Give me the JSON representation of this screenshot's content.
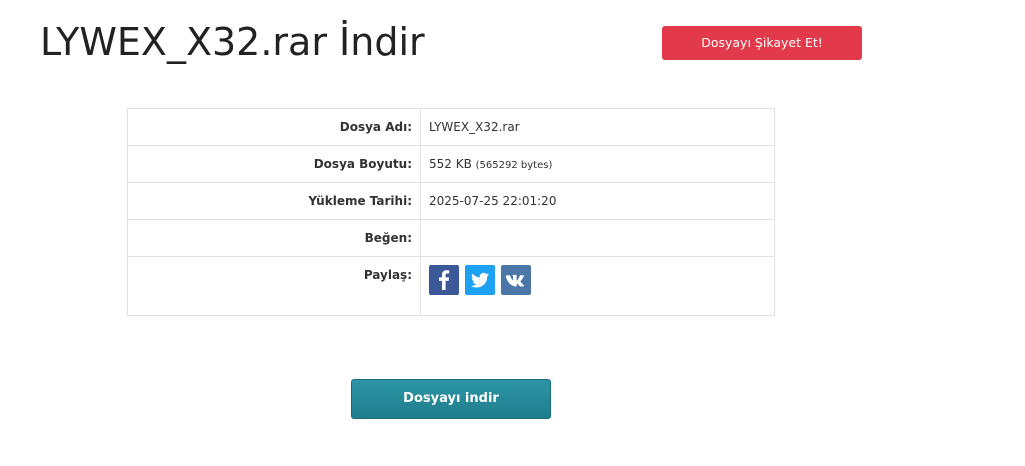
{
  "header": {
    "title": "LYWEX_X32.rar İndir",
    "report_label": "Dosyayı Şikayet Et!"
  },
  "file_info": {
    "rows": [
      {
        "label": "Dosya Adı:",
        "value": "LYWEX_X32.rar"
      },
      {
        "label": "Dosya Boyutu:",
        "value": "552 KB",
        "extra": "(565292 bytes)"
      },
      {
        "label": "Yükleme Tarihi:",
        "value": "2025-07-25 22:01:20"
      },
      {
        "label": "Beğen:",
        "value": ""
      },
      {
        "label": "Paylaş:",
        "value": ""
      }
    ],
    "share": [
      {
        "icon": "facebook-icon",
        "color": "#3b5998"
      },
      {
        "icon": "twitter-icon",
        "color": "#1da1f2"
      },
      {
        "icon": "vk-icon",
        "color": "#4a76a8"
      }
    ]
  },
  "download": {
    "label": "Dosyayı indir",
    "color": "#2589a0"
  },
  "colors": {
    "report": "#e23a4a",
    "border": "#e2e2e2"
  }
}
